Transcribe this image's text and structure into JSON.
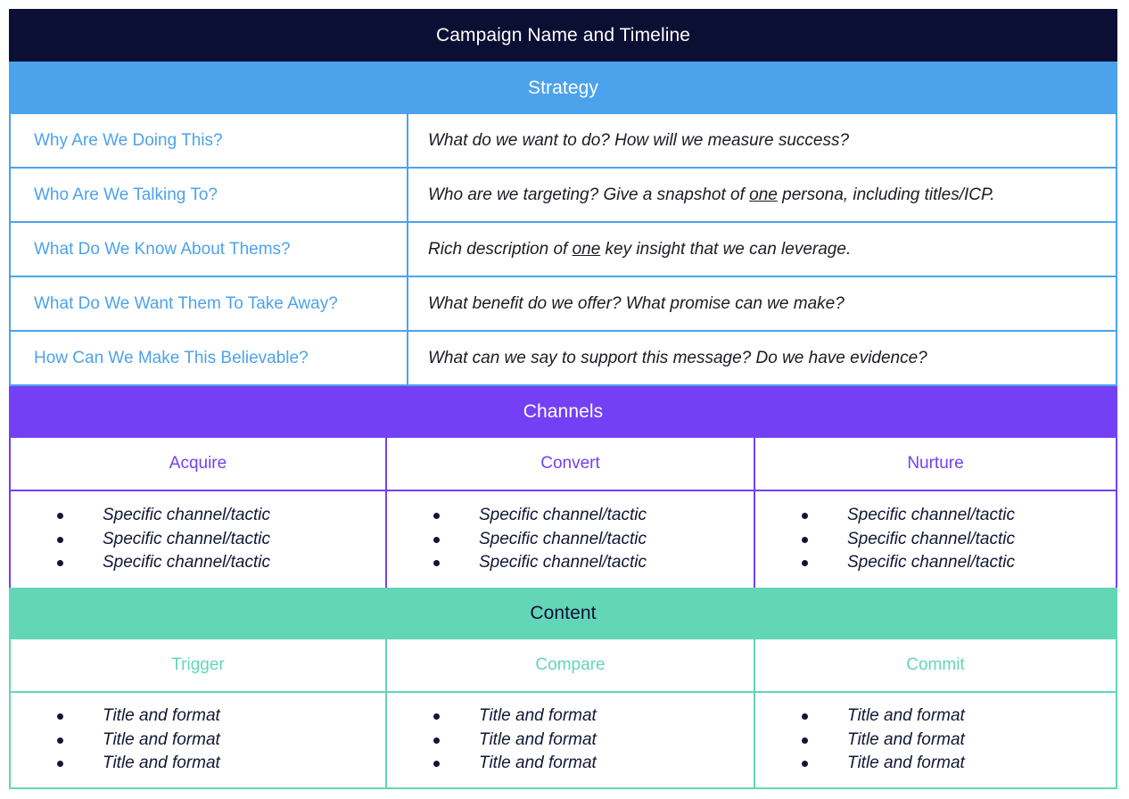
{
  "header": {
    "title": "Campaign Name and Timeline",
    "title_bg": "#0b0f33"
  },
  "strategy": {
    "band_label": "Strategy",
    "band_bg": "#4da2ec",
    "accent": "#4da2ec",
    "rows": [
      {
        "question": "Why Are We Doing This?",
        "answer_prefix": "What do we want to do?  How will we measure success?",
        "answer_underline": "",
        "answer_suffix": ""
      },
      {
        "question": "Who Are We Talking To?",
        "answer_prefix": "Who are we targeting? Give a snapshot of ",
        "answer_underline": "one",
        "answer_suffix": " persona, including titles/ICP."
      },
      {
        "question": "What Do We Know About Thems?",
        "answer_prefix": "Rich description of ",
        "answer_underline": "one",
        "answer_suffix": " key insight that we can leverage."
      },
      {
        "question": "What Do We Want Them To Take Away?",
        "answer_prefix": "What benefit do we offer?  What promise can we make?",
        "answer_underline": "",
        "answer_suffix": ""
      },
      {
        "question": "How Can We Make This Believable?",
        "answer_prefix": "What can we say to support this message?  Do we have evidence?",
        "answer_underline": "",
        "answer_suffix": ""
      }
    ]
  },
  "channels": {
    "band_label": "Channels",
    "band_bg": "#7340f5",
    "accent": "#7340f5",
    "columns": [
      {
        "heading": "Acquire",
        "items": [
          "Specific channel/tactic",
          "Specific channel/tactic",
          "Specific channel/tactic"
        ]
      },
      {
        "heading": "Convert",
        "items": [
          "Specific channel/tactic",
          "Specific channel/tactic",
          "Specific channel/tactic"
        ]
      },
      {
        "heading": "Nurture",
        "items": [
          "Specific channel/tactic",
          "Specific channel/tactic",
          "Specific channel/tactic"
        ]
      }
    ]
  },
  "content": {
    "band_label": "Content",
    "band_bg": "#63d6b8",
    "accent": "#63d6b8",
    "columns": [
      {
        "heading": "Trigger",
        "items": [
          "Title and format",
          "Title and format",
          "Title and format"
        ]
      },
      {
        "heading": "Compare",
        "items": [
          "Title and format",
          "Title and format",
          "Title and format"
        ]
      },
      {
        "heading": "Commit",
        "items": [
          "Title and format",
          "Title and format",
          "Title and format"
        ]
      }
    ]
  }
}
